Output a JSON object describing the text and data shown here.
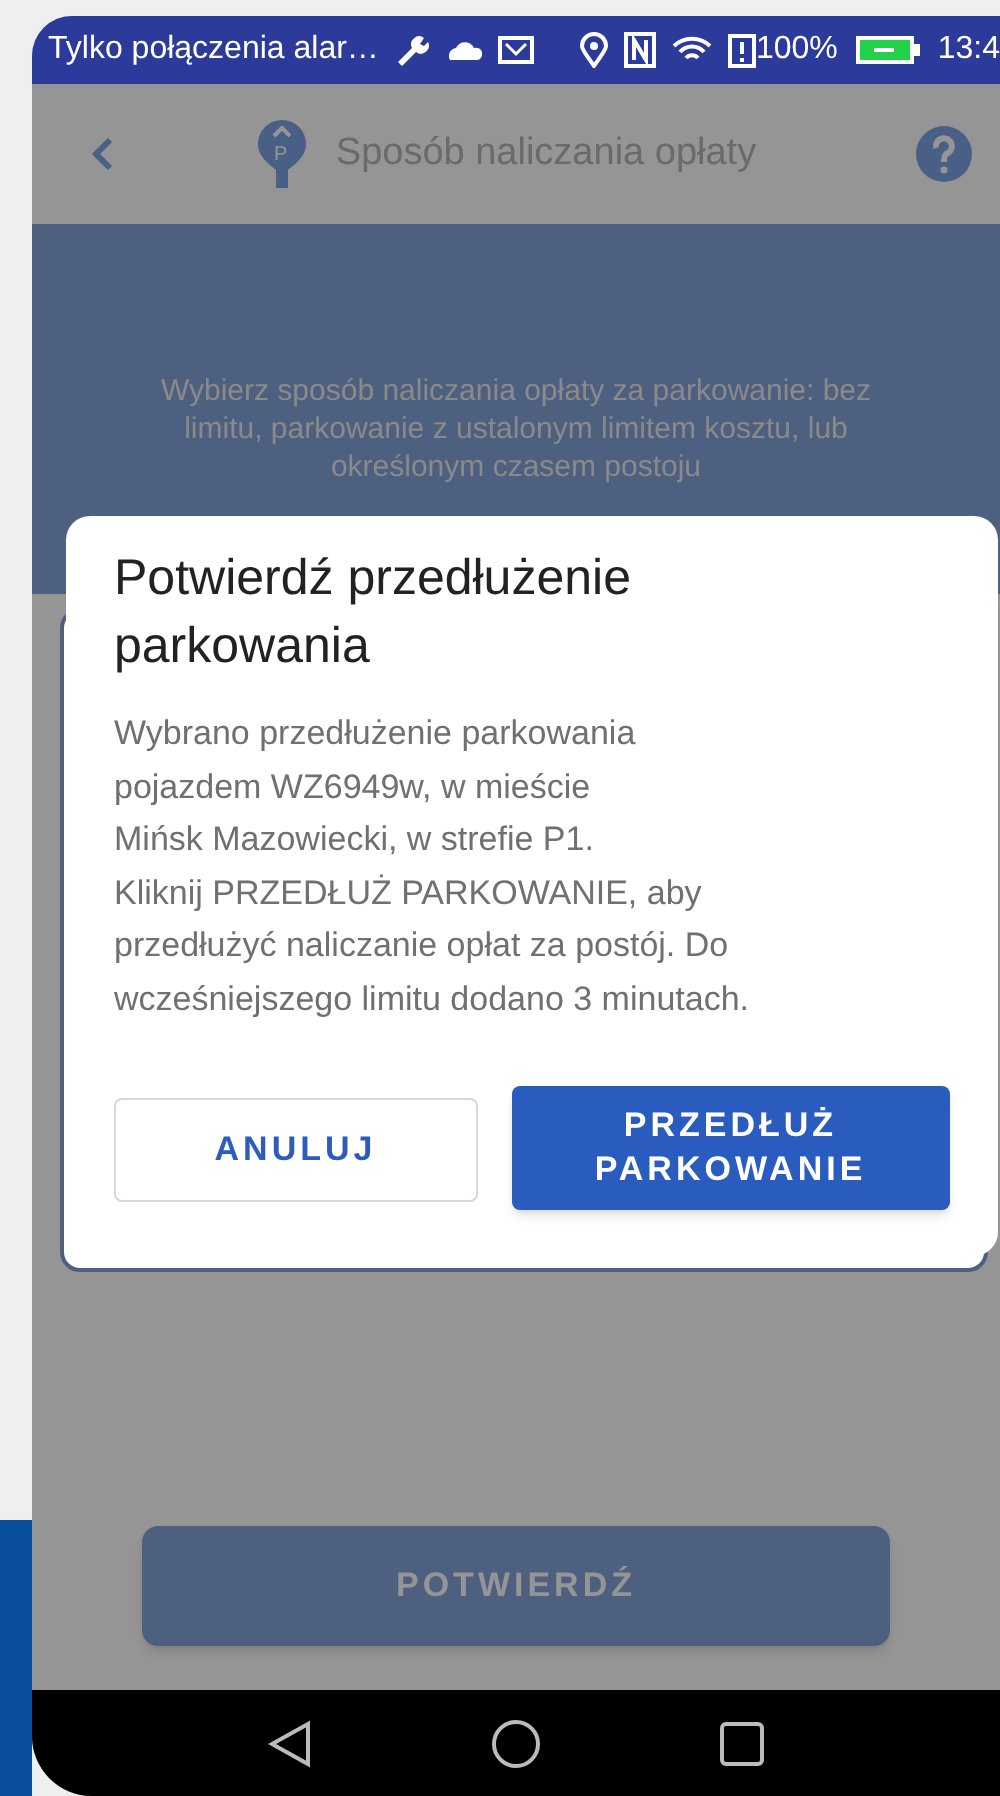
{
  "status_bar": {
    "notification": "Tylko połączenia alar…",
    "battery": "100%",
    "time": "13:4"
  },
  "app_bar": {
    "meter_sign": "P",
    "title": "Sposób naliczania opłaty"
  },
  "intro": "Wybierz sposób naliczania opłaty za parkowanie: bez limitu, parkowanie z ustalonym limitem kosztu, lub określonym czasem postoju",
  "dialog": {
    "title": "Potwierdź przedłużenie parkowania",
    "message": "Wybrano przedłużenie parkowania\npojazdem WZ6949w, w mieście\nMińsk Mazowiecki, w strefie P1.\nKliknij PRZEDŁUŻ PARKOWANIE, aby\nprzedłużyć naliczanie opłat za postój. Do\nwcześniejszego limitu dodano 3 minutach.",
    "buttons": [
      {
        "label": "ANULUJ",
        "kind": "outlined"
      },
      {
        "label": "PRZEDŁUŻ PARKOWANIE",
        "kind": "filled"
      }
    ]
  },
  "confirm_button": {
    "label": "POTWIERDŹ"
  }
}
